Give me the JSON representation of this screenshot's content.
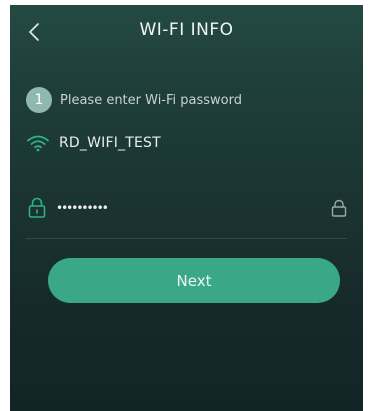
{
  "header": {
    "title": "WI-FI INFO",
    "back_icon": "chevron-left-icon"
  },
  "hint": {
    "step": "1",
    "text": "Please enter Wi-Fi password"
  },
  "network": {
    "icon": "wifi-icon",
    "ssid": "RD_WIFI_TEST"
  },
  "password": {
    "value": "••••••••••",
    "left_icon": "lock-icon",
    "right_icon": "lock-icon"
  },
  "next_button": {
    "label": "Next"
  },
  "colors": {
    "accent": "#3aa886",
    "wifi_icon": "#2fb383",
    "lock_icon": "#2fb383",
    "badge": "#8fb8ae",
    "background_top": "#244a43",
    "background_bottom": "#132427"
  }
}
